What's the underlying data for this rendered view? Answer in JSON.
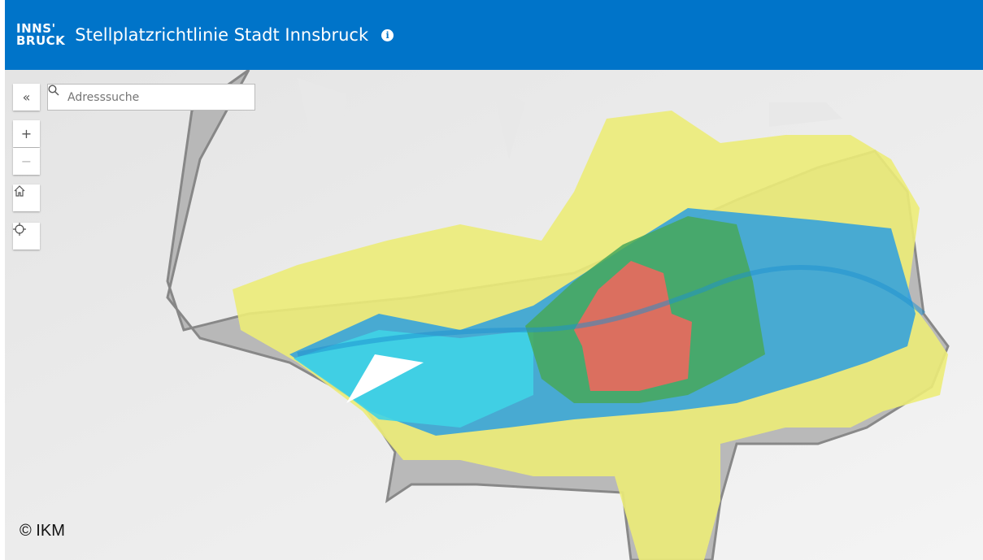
{
  "header": {
    "logo_line1": "INNS'",
    "logo_line2": "BRUCK",
    "title": "Stellplatzrichtlinie Stadt Innsbruck",
    "info_icon": "info-icon"
  },
  "toolbar": {
    "collapse_label": "«",
    "zoom_in_label": "+",
    "zoom_out_label": "−"
  },
  "search": {
    "placeholder": "Adresssuche",
    "value": ""
  },
  "map": {
    "copyright": "© IKM",
    "zone_colors": {
      "outside": "#a9a9a9",
      "yellow": "#eaea7a",
      "blue": "#2aa0e0",
      "cyan": "#3cd2e6",
      "green": "#4aa85a",
      "red": "#e46a5e"
    }
  }
}
